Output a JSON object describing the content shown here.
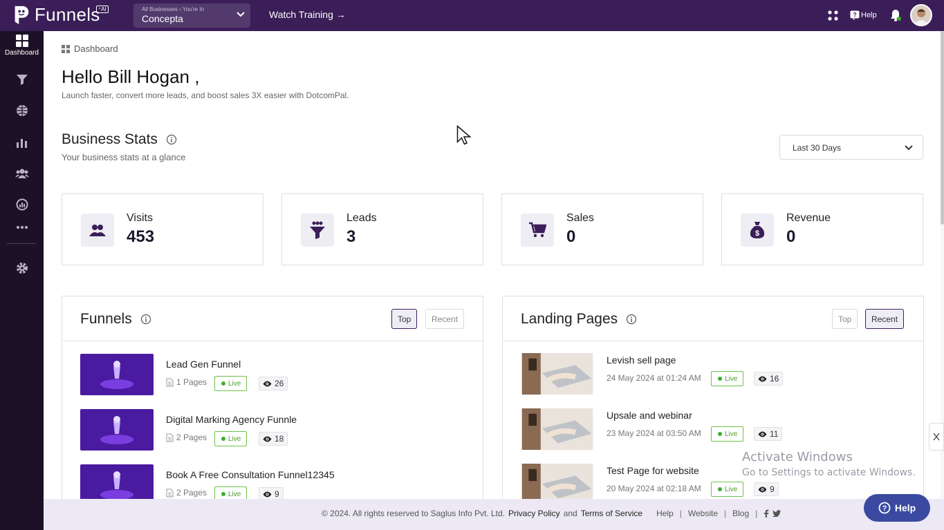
{
  "topbar": {
    "app_name": "Funnels",
    "ai_tag": "⁺AI",
    "business_caption": "All Businesses › You're In",
    "business_name": "Concepta",
    "watch_training": "Watch Training →",
    "help": "Help"
  },
  "sidebar": {
    "items": [
      {
        "label": "Dashboard",
        "icon": "dashboard-icon"
      },
      {
        "icon": "funnel-icon"
      },
      {
        "icon": "globe-icon"
      },
      {
        "icon": "analytics-icon"
      },
      {
        "icon": "contacts-icon"
      },
      {
        "icon": "reports-icon"
      },
      {
        "icon": "more-icon"
      },
      {
        "icon": "settings-icon"
      }
    ]
  },
  "breadcrumb": "Dashboard",
  "greeting": "Hello Bill Hogan ,",
  "greeting_sub": "Launch faster, convert more leads, and boost sales 3X easier with DotcomPal.",
  "stats": {
    "title": "Business Stats",
    "subtitle": "Your business stats at a glance",
    "range": "Last 30 Days",
    "cards": [
      {
        "label": "Visits",
        "value": "453"
      },
      {
        "label": "Leads",
        "value": "3"
      },
      {
        "label": "Sales",
        "value": "0"
      },
      {
        "label": "Revenue",
        "value": "0"
      }
    ]
  },
  "funnels": {
    "title": "Funnels",
    "tab_top": "Top",
    "tab_recent": "Recent",
    "items": [
      {
        "name": "Lead Gen Funnel",
        "pages": "1 Pages",
        "status": "Live",
        "views": "26"
      },
      {
        "name": "Digital Marking Agency Funnle",
        "pages": "2 Pages",
        "status": "Live",
        "views": "18"
      },
      {
        "name": "Book A Free Consultation Funnel12345",
        "pages": "2 Pages",
        "status": "Live",
        "views": "9"
      }
    ]
  },
  "landing": {
    "title": "Landing Pages",
    "tab_top": "Top",
    "tab_recent": "Recent",
    "items": [
      {
        "name": "Levish sell page",
        "date": "24 May 2024 at 01:24 AM",
        "status": "Live",
        "views": "16"
      },
      {
        "name": "Upsale and webinar",
        "date": "23 May 2024 at 03:50 AM",
        "status": "Live",
        "views": "11"
      },
      {
        "name": "Test Page for website",
        "date": "20 May 2024 at 02:18 AM",
        "status": "Live",
        "views": "9"
      }
    ]
  },
  "footer": {
    "copyright": "©  2024. All rights reserved to Saglus Info Pvt. Ltd.",
    "privacy": "Privacy Policy",
    "and": "and",
    "terms": "Terms of Service",
    "help": "Help",
    "website": "Website",
    "blog": "Blog"
  },
  "watermark": {
    "line1": "Activate Windows",
    "line2": "Go to Settings to activate Windows."
  },
  "help_fab": "Help",
  "colors": {
    "brand": "#3b1e58",
    "sidebar": "#1c1126",
    "live": "#3ab02a"
  }
}
